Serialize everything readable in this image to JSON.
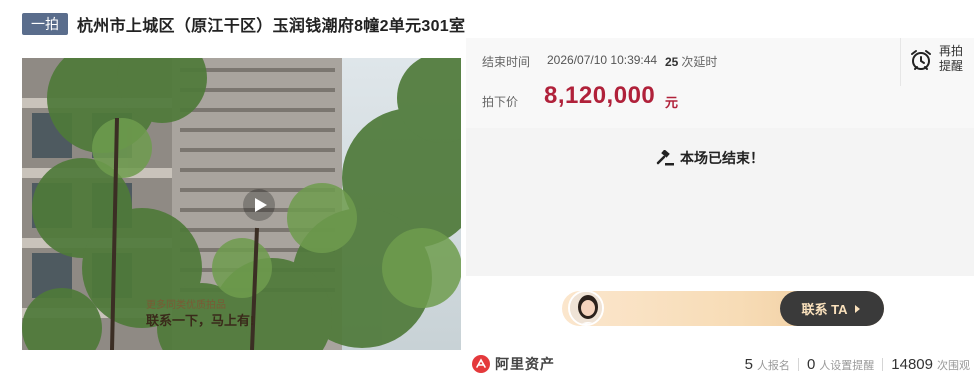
{
  "header": {
    "badge": "一拍",
    "title": "杭州市上城区（原江干区）玉润钱潮府8幢2单元301室"
  },
  "auction": {
    "end_label": "结束时间",
    "end_time": "2026/07/10 10:39:44",
    "delay_count": "25",
    "delay_suffix": "次延时",
    "price_label": "拍下价",
    "price": "8,120,000",
    "price_unit": "元"
  },
  "remind": {
    "label": "再拍提醒",
    "icon": "alarm-clock-icon"
  },
  "status": {
    "text": "本场已结束！",
    "icon": "gavel-icon"
  },
  "promo": {
    "line1": "更多同类优质拍品",
    "line2": "联系一下，马上有!",
    "cta": "联系 TA"
  },
  "footer": {
    "brand": "阿里资产",
    "stats": [
      {
        "value": "5",
        "label": "人报名"
      },
      {
        "value": "0",
        "label": "人设置提醒"
      },
      {
        "value": "14809",
        "label": "次围观"
      }
    ]
  },
  "colors": {
    "price": "#b0213a",
    "badge": "#5a6d8c",
    "cta_bg": "#3a3a3a",
    "brand_red": "#e4393c"
  }
}
